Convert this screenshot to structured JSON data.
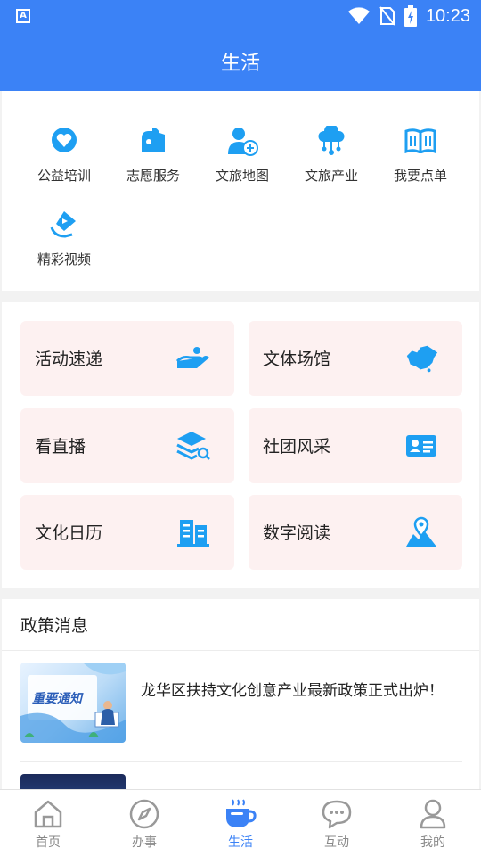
{
  "status_bar": {
    "time": "10:23",
    "app_icon_letter": "A"
  },
  "header": {
    "title": "生活"
  },
  "services": [
    {
      "label": "公益培训",
      "icon": "heart-hand-icon"
    },
    {
      "label": "志愿服务",
      "icon": "hands-icon"
    },
    {
      "label": "文旅地图",
      "icon": "user-add-icon"
    },
    {
      "label": "文旅产业",
      "icon": "cloud-network-icon"
    },
    {
      "label": "我要点单",
      "icon": "book-icon"
    },
    {
      "label": "精彩视频",
      "icon": "video-hand-icon"
    }
  ],
  "cards": [
    {
      "label": "活动速递",
      "icon": "helping-hand-icon"
    },
    {
      "label": "文体场馆",
      "icon": "china-map-icon"
    },
    {
      "label": "看直播",
      "icon": "layers-search-icon"
    },
    {
      "label": "社团风采",
      "icon": "id-card-icon"
    },
    {
      "label": "文化日历",
      "icon": "building-icon"
    },
    {
      "label": "数字阅读",
      "icon": "map-pin-icon"
    }
  ],
  "news": {
    "section_title": "政策消息",
    "items": [
      {
        "title": "龙华区扶持文化创意产业最新政策正式出炉！",
        "thumb_text": "重要通知"
      }
    ]
  },
  "tabbar": [
    {
      "label": "首页",
      "icon": "home-icon",
      "active": false
    },
    {
      "label": "办事",
      "icon": "compass-icon",
      "active": false
    },
    {
      "label": "生活",
      "icon": "coffee-cup-icon",
      "active": true
    },
    {
      "label": "互动",
      "icon": "chat-bubble-icon",
      "active": false
    },
    {
      "label": "我的",
      "icon": "user-icon",
      "active": false
    }
  ],
  "colors": {
    "primary": "#3b82f6",
    "accent": "#1e9ff2",
    "card_bg": "#fdf1f1"
  }
}
